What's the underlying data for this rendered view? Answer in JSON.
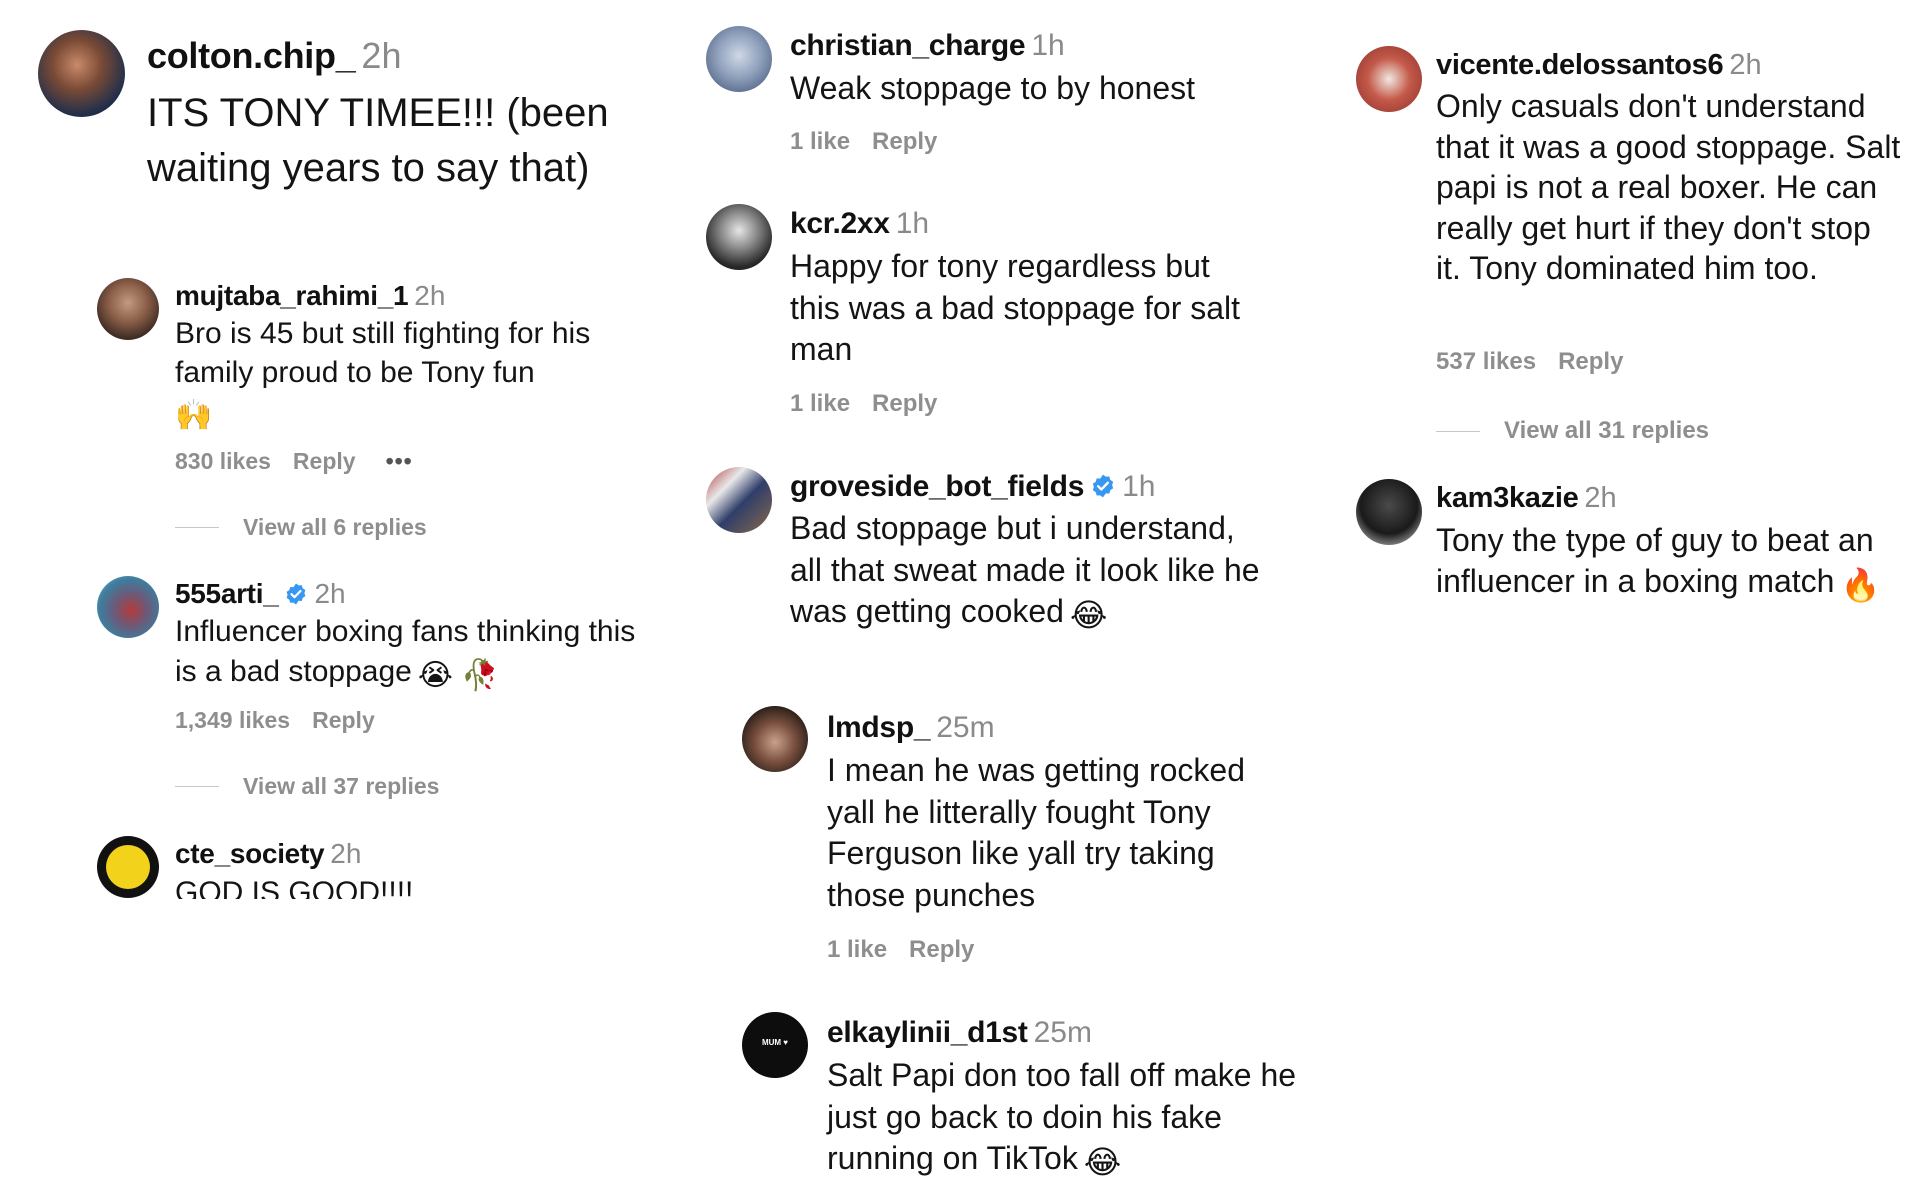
{
  "comments": {
    "c1": {
      "user": "colton.chip_",
      "time": "2h",
      "text": "ITS TONY TIMEE!!! (been waiting years to say that)"
    },
    "c2": {
      "user": "mujtaba_rahimi_1",
      "time": "2h",
      "text": "Bro is 45 but still fighting for his family proud to be Tony fun",
      "emoji": "🙌",
      "likes": "830 likes",
      "reply": "Reply",
      "more": "•••",
      "view": "View all 6 replies"
    },
    "c3": {
      "user": "555arti_",
      "time": "2h",
      "text": "Influencer boxing fans thinking this is a bad stoppage",
      "emoji": "😭 🥀",
      "likes": "1,349 likes",
      "reply": "Reply",
      "view": "View all 37 replies"
    },
    "c4": {
      "user": "cte_society",
      "time": "2h",
      "text": "GOD IS GOOD!!!!"
    },
    "c5": {
      "user": "christian_charge",
      "time": "1h",
      "text": "Weak stoppage to by honest",
      "likes": "1 like",
      "reply": "Reply"
    },
    "c6": {
      "user": "kcr.2xx",
      "time": "1h",
      "text": "Happy for tony regardless but this was a bad stoppage for salt man",
      "likes": "1 like",
      "reply": "Reply"
    },
    "c7": {
      "user": "groveside_bot_fields",
      "time": "1h",
      "text": "Bad stoppage but i understand, all that sweat made it look like he was getting cooked",
      "emoji": "😂"
    },
    "c8": {
      "user": "lmdsp_",
      "time": "25m",
      "text": "I mean he was getting rocked yall he litterally fought Tony Ferguson like yall try taking those punches",
      "likes": "1 like",
      "reply": "Reply"
    },
    "c9": {
      "user": "elkaylinii_d1st",
      "time": "25m",
      "text": "Salt Papi don too fall off make he just go back to doin his fake running on TikTok",
      "emoji": "😂",
      "avatar_text": "MUM ♥"
    },
    "c10": {
      "user": "vicente.delossantos6",
      "time": "2h",
      "text": "Only casuals don't understand that it was a good stoppage. Salt papi is not a real boxer. He can really get hurt if they don't stop it. Tony dominated him too.",
      "likes": "537 likes",
      "reply": "Reply",
      "view": "View all 31 replies"
    },
    "c11": {
      "user": "kam3kazie",
      "time": "2h",
      "text": "Tony the type of guy to beat an influencer in a boxing match",
      "emoji": "🔥"
    }
  },
  "colors": {
    "username": "#111111",
    "timestamp": "#8a8a8a",
    "meta": "#8e8e8e",
    "verified": "#3897f0"
  }
}
